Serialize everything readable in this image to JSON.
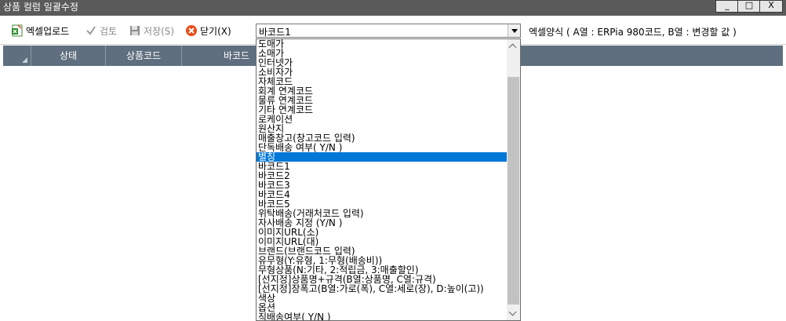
{
  "window": {
    "title": "상품 컬럼 일괄수정",
    "minimize_label": "_",
    "maximize_label": "□",
    "close_label": "X"
  },
  "toolbar": {
    "excel_upload_label": "엑셀업로드",
    "check_label": "검토",
    "save_label": "저장(S)",
    "close_label": "닫기(X)",
    "selected_column": "바코드1",
    "excel_format_hint": "엑셀양식 ( A열 : ERPia 980코드, B열 : 변경할 값 )"
  },
  "grid": {
    "columns": [
      "상태",
      "상품코드",
      "바코드"
    ]
  },
  "dropdown": {
    "selected_index": 12,
    "items": [
      "도매가",
      "소매가",
      "인터넷가",
      "소비자가",
      "자체코드",
      "회계 연계코드",
      "물류 연계코드",
      "기타 연계코드",
      "로케이션",
      "원산지",
      "매출창고(창고코드 입력)",
      "단독배송 여부( Y/N )",
      "별칭",
      "바코드1",
      "바코드2",
      "바코드3",
      "바코드4",
      "바코드5",
      "위탁배송(거래처코드 입력)",
      "자사배송 지정 (Y/N )",
      "이미지URL(소)",
      "이미지URL(대)",
      "브랜드(브랜드코드 입력)",
      "유무형(Y:유형, 1:무형(배송비))",
      "무형상품(N:기타, 2:적립금, 3:매출할인)",
      "[선지정]상품명+규격(B열:상품명, C열:규격)",
      "[선지정]장폭고(B열:가로(폭), C열:세로(장), D:높이(고))",
      "색상",
      "옵션",
      "직배송여부( Y/N )"
    ]
  },
  "colors": {
    "title_bar": "#5a5a5a",
    "grid_header": "#5f6f7f",
    "selection": "#0078d7"
  }
}
